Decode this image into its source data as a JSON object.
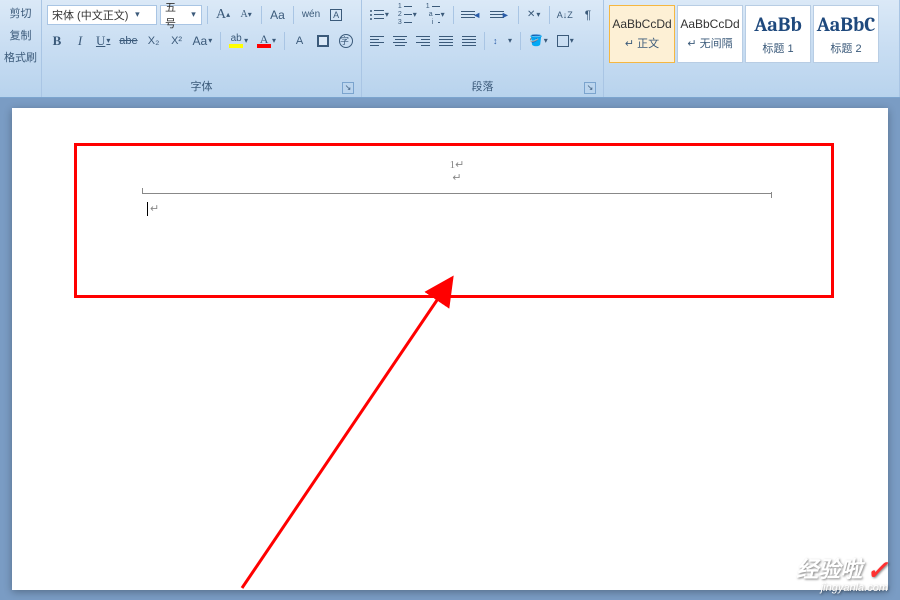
{
  "clipboard": {
    "cut": "剪切",
    "copy": "复制",
    "format_painter": "格式刷"
  },
  "font": {
    "group_label": "字体",
    "font_name": "宋体 (中文正文)",
    "font_size": "五号",
    "grow": "A",
    "shrink": "A",
    "clear_format": "Aa",
    "pinyin": "wén",
    "char_border": "A",
    "bold": "B",
    "italic": "I",
    "underline": "U",
    "strike": "abe",
    "subscript": "X₂",
    "superscript": "X²",
    "change_case": "Aa",
    "highlight_glyph": "ab",
    "font_color_glyph": "A",
    "char_scale": "A"
  },
  "paragraph": {
    "group_label": "段落",
    "sort": "A↓Z",
    "show_marks": "¶"
  },
  "styles": {
    "items": [
      {
        "preview": "AaBbCcDd",
        "label": "↵ 正文",
        "selected": true,
        "heading": false
      },
      {
        "preview": "AaBbCcDd",
        "label": "↵ 无间隔",
        "selected": false,
        "heading": false
      },
      {
        "preview": "AaBb",
        "label": "标题 1",
        "selected": false,
        "heading": true
      },
      {
        "preview": "AaBbC",
        "label": "标题 2",
        "selected": false,
        "heading": true
      }
    ]
  },
  "document": {
    "header_page_number": "1",
    "cursor_glyph": "↵"
  },
  "watermark": {
    "main": "经验啦",
    "check": "✓",
    "sub": "jingyanla.com"
  }
}
